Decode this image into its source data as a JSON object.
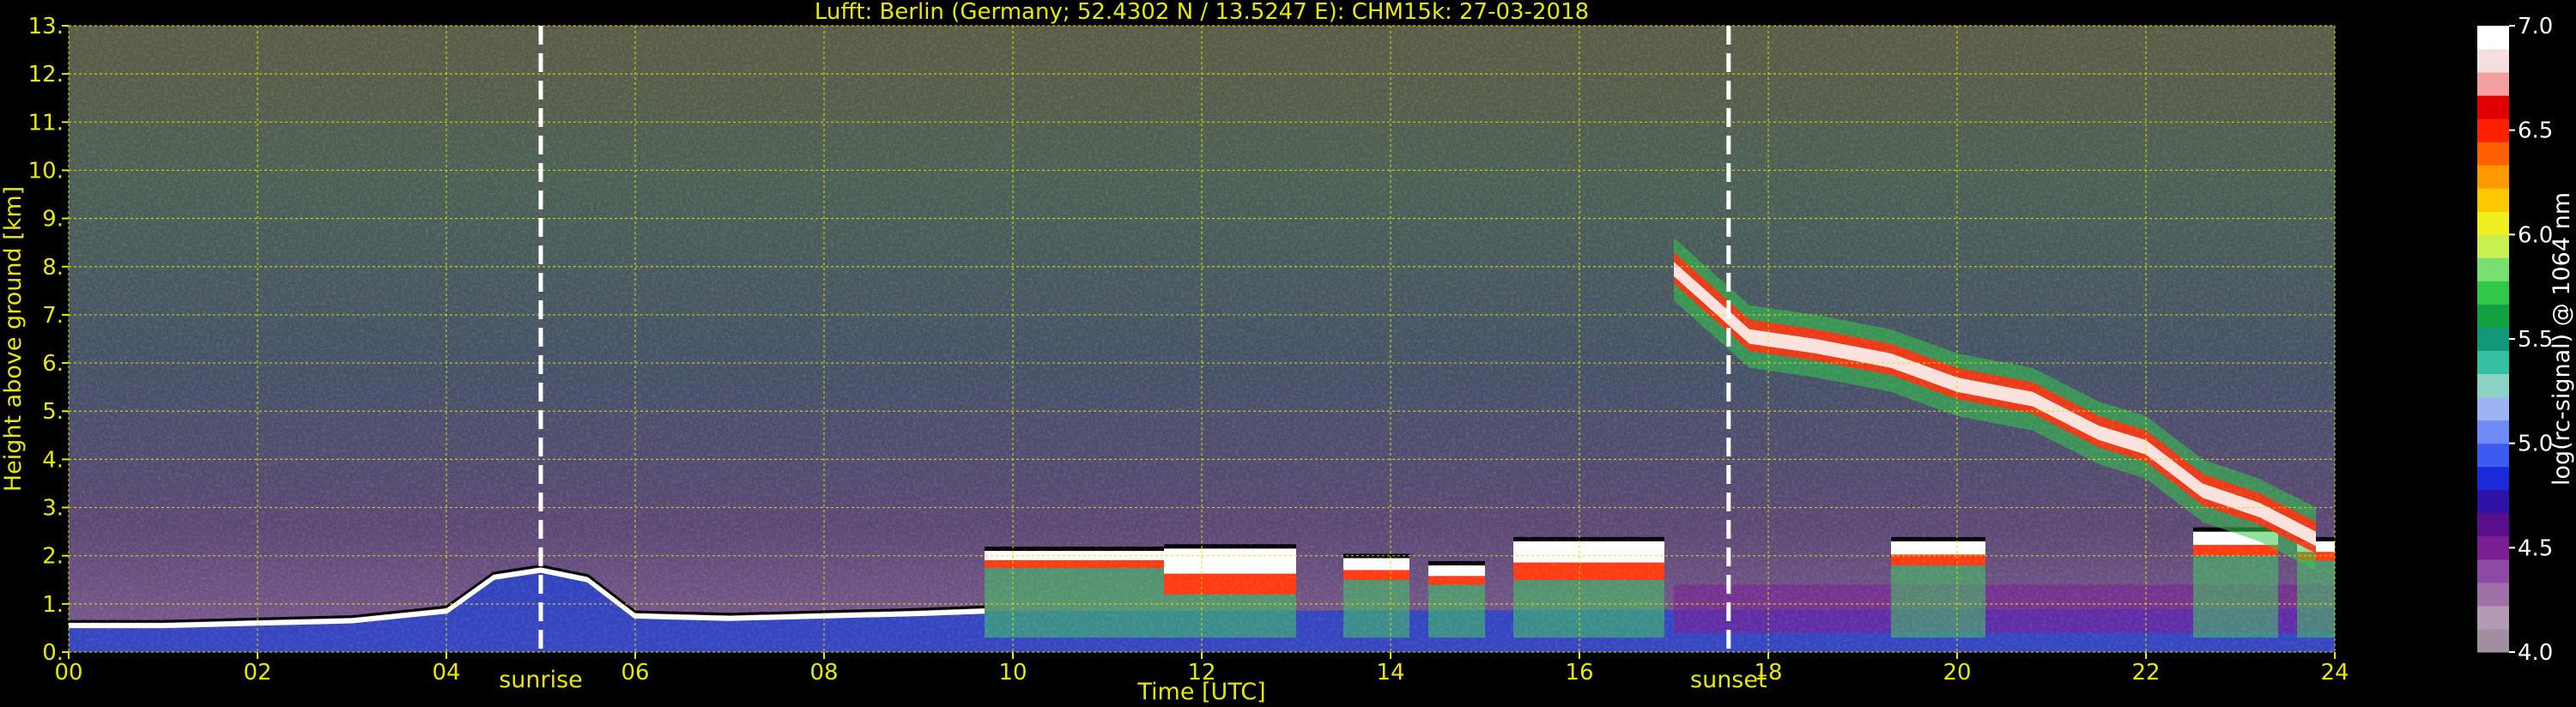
{
  "chart_data": {
    "type": "heatmap",
    "title": "Lufft: Berlin (Germany; 52.4302 N / 13.5247 E):    CHM15k: 27-03-2018",
    "xlabel": "Time [UTC]",
    "ylabel": "Height above ground [km]",
    "xlim": [
      0,
      24
    ],
    "ylim": [
      0,
      13
    ],
    "x_ticks": [
      "00",
      "02",
      "04",
      "06",
      "08",
      "10",
      "12",
      "14",
      "16",
      "18",
      "20",
      "22",
      "24"
    ],
    "y_ticks": [
      "0.",
      "1.",
      "2.",
      "3.",
      "4.",
      "5.",
      "6.",
      "7.",
      "8.",
      "9.",
      "10.",
      "11.",
      "12.",
      "13."
    ],
    "grid": true,
    "colorbar": {
      "label": "log(rc-signal) @ 1064 nm",
      "range": [
        4.0,
        7.0
      ],
      "ticks": [
        "4.0",
        "4.5",
        "5.0",
        "5.5",
        "6.0",
        "6.5",
        "7.0"
      ],
      "colors": [
        "#a08fa0",
        "#b49ab4",
        "#a070a8",
        "#8d49a4",
        "#7a1e94",
        "#5a0f8a",
        "#2e12a8",
        "#1a2ad8",
        "#3c5bf0",
        "#6f8cf6",
        "#9db4f4",
        "#8ad2c4",
        "#35c0a4",
        "#109878",
        "#12a040",
        "#30c848",
        "#78e070",
        "#c8f050",
        "#f0f020",
        "#ffc800",
        "#ff9a00",
        "#ff6000",
        "#ff2000",
        "#e00000",
        "#f4a0a0",
        "#f4dede",
        "#ffffff"
      ]
    },
    "markers": [
      {
        "label": "sunrise",
        "x": 5.0
      },
      {
        "label": "sunset",
        "x": 17.58
      }
    ],
    "features": {
      "boundary_layer_top": [
        [
          0,
          0.55
        ],
        [
          1,
          0.55
        ],
        [
          2,
          0.6
        ],
        [
          3,
          0.65
        ],
        [
          4,
          0.85
        ],
        [
          4.5,
          1.55
        ],
        [
          5,
          1.7
        ],
        [
          5.5,
          1.5
        ],
        [
          6,
          0.75
        ],
        [
          7,
          0.7
        ],
        [
          8,
          0.75
        ],
        [
          9,
          0.8
        ],
        [
          9.7,
          0.85
        ]
      ],
      "low_cloud_segments": [
        {
          "x": [
            9.7,
            11.6
          ],
          "top": 2.1,
          "base": 1.75
        },
        {
          "x": [
            11.6,
            13.0
          ],
          "top": 2.15,
          "base": 1.2
        },
        {
          "x": [
            13.5,
            14.2
          ],
          "top": 1.95,
          "base": 1.5
        },
        {
          "x": [
            14.4,
            15.0
          ],
          "top": 1.8,
          "base": 1.4
        },
        {
          "x": [
            15.3,
            16.9
          ],
          "top": 2.3,
          "base": 1.5
        },
        {
          "x": [
            19.3,
            20.3
          ],
          "top": 2.3,
          "base": 1.8
        },
        {
          "x": [
            22.5,
            23.4
          ],
          "top": 2.5,
          "base": 2.0
        },
        {
          "x": [
            23.6,
            24.0
          ],
          "top": 2.3,
          "base": 1.9
        }
      ],
      "cirrus_deck": [
        [
          17.0,
          8.6
        ],
        [
          17.8,
          7.2
        ],
        [
          18.5,
          7.0
        ],
        [
          19.3,
          6.7
        ],
        [
          20.0,
          6.2
        ],
        [
          20.8,
          5.9
        ],
        [
          21.5,
          5.2
        ],
        [
          22.0,
          4.9
        ],
        [
          22.6,
          4.0
        ],
        [
          23.2,
          3.6
        ],
        [
          23.8,
          3.0
        ]
      ]
    }
  }
}
